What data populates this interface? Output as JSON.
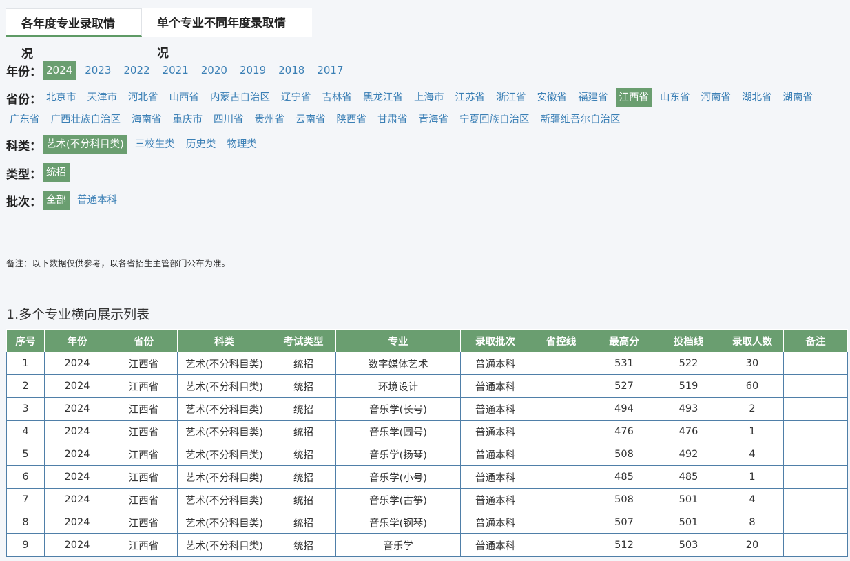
{
  "tabs": [
    {
      "label": "各年度专业录取情况",
      "active": true
    },
    {
      "label": "单个专业不同年度录取情况",
      "active": false
    }
  ],
  "filters": {
    "year": {
      "label": "年份：",
      "options": [
        "2024",
        "2023",
        "2022",
        "2021",
        "2020",
        "2019",
        "2018",
        "2017"
      ],
      "selected": "2024"
    },
    "province": {
      "label": "省份：",
      "options": [
        "北京市",
        "天津市",
        "河北省",
        "山西省",
        "内蒙古自治区",
        "辽宁省",
        "吉林省",
        "黑龙江省",
        "上海市",
        "江苏省",
        "浙江省",
        "安徽省",
        "福建省",
        "江西省",
        "山东省",
        "河南省",
        "湖北省",
        "湖南省",
        "广东省",
        "广西壮族自治区",
        "海南省",
        "重庆市",
        "四川省",
        "贵州省",
        "云南省",
        "陕西省",
        "甘肃省",
        "青海省",
        "宁夏回族自治区",
        "新疆维吾尔自治区"
      ],
      "selected": "江西省"
    },
    "subject": {
      "label": "科类：",
      "options": [
        "艺术(不分科目类)",
        "三校生类",
        "历史类",
        "物理类"
      ],
      "selected": "艺术(不分科目类)"
    },
    "type": {
      "label": "类型：",
      "options": [
        "统招"
      ],
      "selected": "统招"
    },
    "batch": {
      "label": "批次：",
      "options": [
        "全部",
        "普通本科"
      ],
      "selected": "全部"
    }
  },
  "note": "备注：以下数据仅供参考，以各省招生主管部门公布为准。",
  "section_title": "1.多个专业横向展示列表",
  "table": {
    "columns": [
      "序号",
      "年份",
      "省份",
      "科类",
      "考试类型",
      "专业",
      "录取批次",
      "省控线",
      "最高分",
      "投档线",
      "录取人数",
      "备注"
    ],
    "rows": [
      [
        "1",
        "2024",
        "江西省",
        "艺术(不分科目类)",
        "统招",
        "数字媒体艺术",
        "普通本科",
        "",
        "531",
        "522",
        "30",
        ""
      ],
      [
        "2",
        "2024",
        "江西省",
        "艺术(不分科目类)",
        "统招",
        "环境设计",
        "普通本科",
        "",
        "527",
        "519",
        "60",
        ""
      ],
      [
        "3",
        "2024",
        "江西省",
        "艺术(不分科目类)",
        "统招",
        "音乐学(长号)",
        "普通本科",
        "",
        "494",
        "493",
        "2",
        ""
      ],
      [
        "4",
        "2024",
        "江西省",
        "艺术(不分科目类)",
        "统招",
        "音乐学(圆号)",
        "普通本科",
        "",
        "476",
        "476",
        "1",
        ""
      ],
      [
        "5",
        "2024",
        "江西省",
        "艺术(不分科目类)",
        "统招",
        "音乐学(扬琴)",
        "普通本科",
        "",
        "508",
        "492",
        "4",
        ""
      ],
      [
        "6",
        "2024",
        "江西省",
        "艺术(不分科目类)",
        "统招",
        "音乐学(小号)",
        "普通本科",
        "",
        "485",
        "485",
        "1",
        ""
      ],
      [
        "7",
        "2024",
        "江西省",
        "艺术(不分科目类)",
        "统招",
        "音乐学(古筝)",
        "普通本科",
        "",
        "508",
        "501",
        "4",
        ""
      ],
      [
        "8",
        "2024",
        "江西省",
        "艺术(不分科目类)",
        "统招",
        "音乐学(钢琴)",
        "普通本科",
        "",
        "507",
        "501",
        "8",
        ""
      ],
      [
        "9",
        "2024",
        "江西省",
        "艺术(不分科目类)",
        "统招",
        "音乐学",
        "普通本科",
        "",
        "512",
        "503",
        "20",
        ""
      ]
    ]
  },
  "colors": {
    "accent_green": "#6a9e70",
    "link_blue": "#3a7fb5",
    "table_border": "#4f7fa8",
    "background": "#f4f6f9"
  }
}
